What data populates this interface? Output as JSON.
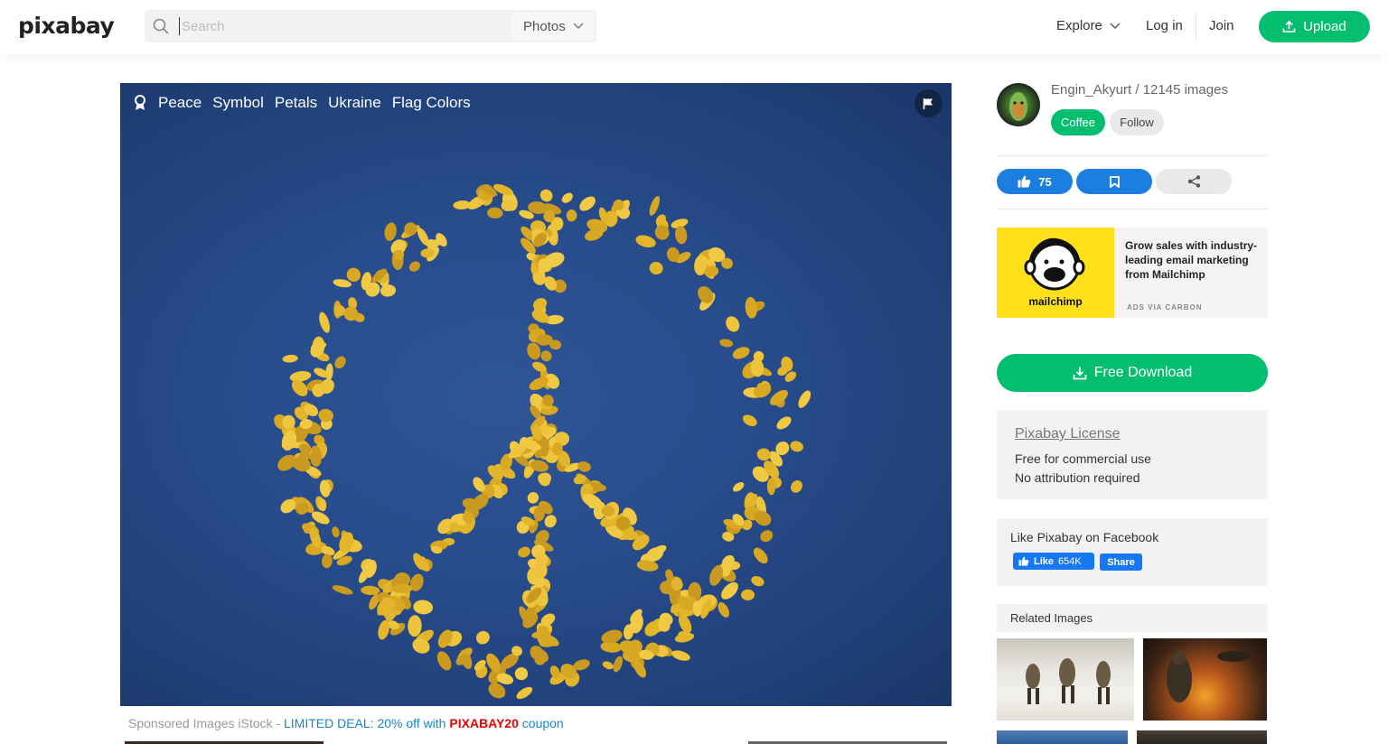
{
  "header": {
    "logo": "pixabay",
    "search": {
      "placeholder": "Search",
      "value": ""
    },
    "type_select": "Photos",
    "nav": {
      "explore": "Explore",
      "login": "Log in",
      "join": "Join",
      "upload": "Upload"
    }
  },
  "image": {
    "tags": [
      "Peace",
      "Symbol",
      "Petals",
      "Ukraine",
      "Flag Colors"
    ],
    "icons": {
      "tags": "award-ribbon-icon",
      "report": "flag-icon"
    },
    "colors": {
      "background": "#284c8c",
      "petals": "#e2b52a"
    }
  },
  "sponsored": {
    "prefix": "Sponsored Images iStock - ",
    "deal": "LIMITED DEAL: 20% off with ",
    "code": "PIXABAY20",
    "suffix": " coupon"
  },
  "author": {
    "name_line": "Engin_Akyurt / 12145 images",
    "coffee": "Coffee",
    "follow": "Follow"
  },
  "actions": {
    "like_count": "75",
    "icons": {
      "like": "thumbs-up-icon",
      "save": "bookmark-icon",
      "share": "share-icon"
    }
  },
  "ad": {
    "brand": "mailchimp",
    "text": "Grow sales with industry-leading email marketing from Mailchimp",
    "via": "ADS VIA CARBON"
  },
  "download": {
    "label": "Free Download"
  },
  "license": {
    "title": "Pixabay License",
    "line1": "Free for commercial use",
    "line2": "No attribution required"
  },
  "facebook": {
    "title": "Like Pixabay on Facebook",
    "like_label": "Like",
    "like_count": "654K",
    "share_label": "Share"
  },
  "related": {
    "title": "Related Images"
  },
  "colors": {
    "accent_green": "#02be6e",
    "accent_blue": "#1c7fe0",
    "link_blue": "#1785c9",
    "coupon_red": "#e00000",
    "facebook_blue": "#1877f2"
  }
}
